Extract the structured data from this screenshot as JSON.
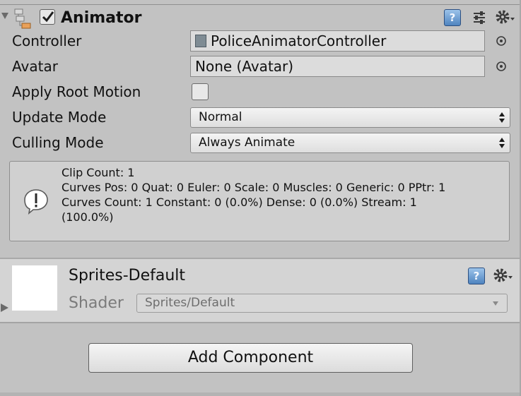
{
  "animator": {
    "title": "Animator",
    "enabled": true,
    "help_icon_glyph": "?",
    "fields": {
      "controller": {
        "label": "Controller",
        "value": "PoliceAnimatorController"
      },
      "avatar": {
        "label": "Avatar",
        "value": "None (Avatar)"
      },
      "apply_root_motion": {
        "label": "Apply Root Motion",
        "checked": false
      },
      "update_mode": {
        "label": "Update Mode",
        "value": "Normal"
      },
      "culling_mode": {
        "label": "Culling Mode",
        "value": "Always Animate"
      }
    },
    "info": {
      "line1": "Clip Count: 1",
      "line2": "Curves Pos: 0 Quat: 0 Euler: 0 Scale: 0 Muscles: 0 Generic: 0 PPtr: 1",
      "line3": "Curves Count: 1 Constant: 0 (0.0%) Dense: 0 (0.0%) Stream: 1",
      "line4": "(100.0%)"
    }
  },
  "material": {
    "name": "Sprites-Default",
    "shader_label": "Shader",
    "shader_value": "Sprites/Default",
    "help_icon_glyph": "?"
  },
  "add_component": {
    "label": "Add Component"
  },
  "icons": {
    "component": "animator-component-icon",
    "help": "help-book-icon",
    "preset": "preset-sliders-icon",
    "gear": "gear-icon",
    "picker": "object-picker-icon",
    "info": "info-icon",
    "dropdown": "dropdown-arrows-icon"
  },
  "colors": {
    "panel": "#c2c2c2",
    "field": "#dcdcdc",
    "help_icon": "#4f84bf"
  }
}
